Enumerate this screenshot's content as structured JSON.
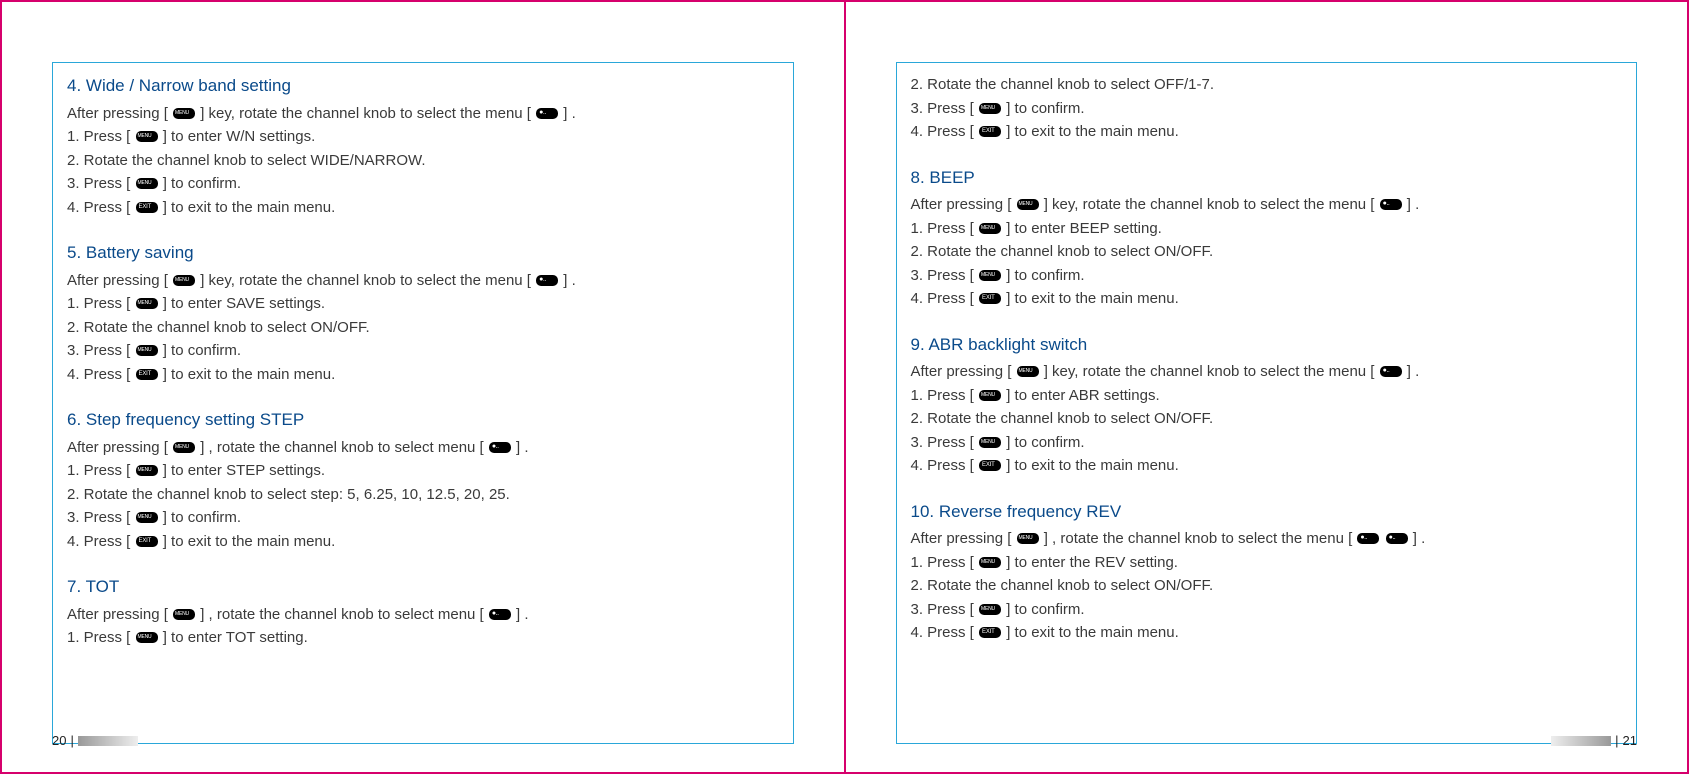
{
  "left": {
    "page_number": "20",
    "sections": [
      {
        "title": "4. Wide / Narrow band setting",
        "lines": [
          {
            "parts": [
              "After pressing [ ",
              {
                "key": "MENU"
              },
              " ] key, rotate the channel knob to select the menu [ ",
              {
                "key": "4"
              },
              " ] ."
            ]
          },
          {
            "parts": [
              "1. Press [ ",
              {
                "key": "MENU"
              },
              " ] to enter W/N settings."
            ]
          },
          {
            "parts": [
              "2. Rotate the channel knob to select WIDE/NARROW."
            ]
          },
          {
            "parts": [
              "3. Press [ ",
              {
                "key": "MENU"
              },
              " ] to confirm."
            ]
          },
          {
            "parts": [
              "4. Press [ ",
              {
                "key": "EXIT"
              },
              " ] to exit to the main menu."
            ]
          }
        ]
      },
      {
        "title": "5. Battery saving",
        "lines": [
          {
            "parts": [
              "After pressing [ ",
              {
                "key": "MENU"
              },
              " ] key, rotate the channel knob to select the menu [ ",
              {
                "key": "5"
              },
              " ] ."
            ]
          },
          {
            "parts": [
              "1. Press [ ",
              {
                "key": "MENU"
              },
              " ] to enter SAVE settings."
            ]
          },
          {
            "parts": [
              "2. Rotate the channel knob to select ON/OFF."
            ]
          },
          {
            "parts": [
              "3. Press [ ",
              {
                "key": "MENU"
              },
              " ] to confirm."
            ]
          },
          {
            "parts": [
              "4. Press [ ",
              {
                "key": "EXIT"
              },
              " ] to exit to the main menu."
            ]
          }
        ]
      },
      {
        "title": "6. Step frequency setting STEP",
        "lines": [
          {
            "parts": [
              "After pressing [ ",
              {
                "key": "MENU"
              },
              " ] , rotate the channel knob to select menu [ ",
              {
                "key": "6"
              },
              " ] ."
            ]
          },
          {
            "parts": [
              "1. Press [ ",
              {
                "key": "MENU"
              },
              " ] to enter STEP settings."
            ]
          },
          {
            "parts": [
              "2. Rotate the channel knob to select step: 5, 6.25, 10, 12.5, 20, 25."
            ]
          },
          {
            "parts": [
              "3. Press [ ",
              {
                "key": "MENU"
              },
              " ] to confirm."
            ]
          },
          {
            "parts": [
              "4. Press [ ",
              {
                "key": "EXIT"
              },
              " ] to exit to the main menu."
            ]
          }
        ]
      },
      {
        "title": "7. TOT",
        "lines": [
          {
            "parts": [
              "After pressing [ ",
              {
                "key": "MENU"
              },
              " ] , rotate the channel knob to select menu [ ",
              {
                "key": "7"
              },
              " ] ."
            ]
          },
          {
            "parts": [
              "1. Press [ ",
              {
                "key": "MENU"
              },
              " ] to enter TOT setting."
            ]
          }
        ]
      }
    ]
  },
  "right": {
    "page_number": "21",
    "prelines": [
      {
        "parts": [
          "2. Rotate the channel knob to select OFF/1-7."
        ]
      },
      {
        "parts": [
          "3. Press [ ",
          {
            "key": "MENU"
          },
          " ] to confirm."
        ]
      },
      {
        "parts": [
          "4. Press [ ",
          {
            "key": "EXIT"
          },
          " ] to exit to the main menu."
        ]
      }
    ],
    "sections": [
      {
        "title": "8. BEEP",
        "lines": [
          {
            "parts": [
              "After pressing [ ",
              {
                "key": "MENU"
              },
              " ] key, rotate the channel knob to select the menu [ ",
              {
                "key": "8"
              },
              " ] ."
            ]
          },
          {
            "parts": [
              "1. Press [ ",
              {
                "key": "MENU"
              },
              " ] to enter BEEP setting."
            ]
          },
          {
            "parts": [
              "2. Rotate the channel knob to select ON/OFF."
            ]
          },
          {
            "parts": [
              "3. Press [ ",
              {
                "key": "MENU"
              },
              " ] to confirm."
            ]
          },
          {
            "parts": [
              "4. Press [ ",
              {
                "key": "EXIT"
              },
              " ] to exit to the main menu."
            ]
          }
        ]
      },
      {
        "title": "9. ABR backlight switch",
        "lines": [
          {
            "parts": [
              "After pressing [ ",
              {
                "key": "MENU"
              },
              " ] key, rotate the channel knob to select the menu [ ",
              {
                "key": "9"
              },
              " ] ."
            ]
          },
          {
            "parts": [
              "1. Press [ ",
              {
                "key": "MENU"
              },
              " ] to enter ABR settings."
            ]
          },
          {
            "parts": [
              "2. Rotate the channel knob to select ON/OFF."
            ]
          },
          {
            "parts": [
              "3. Press [ ",
              {
                "key": "MENU"
              },
              " ] to confirm."
            ]
          },
          {
            "parts": [
              "4. Press [ ",
              {
                "key": "EXIT"
              },
              " ] to exit to the main menu."
            ]
          }
        ]
      },
      {
        "title": "10. Reverse frequency REV",
        "lines": [
          {
            "parts": [
              "After pressing [ ",
              {
                "key": "MENU"
              },
              " ] , rotate the channel knob to select the menu [ ",
              {
                "key": "1"
              },
              " ",
              {
                "key": "0"
              },
              " ] ."
            ]
          },
          {
            "parts": [
              "1. Press [ ",
              {
                "key": "MENU"
              },
              " ] to enter the REV setting."
            ]
          },
          {
            "parts": [
              "2. Rotate the channel knob to select ON/OFF."
            ]
          },
          {
            "parts": [
              "3. Press [ ",
              {
                "key": "MENU"
              },
              " ] to confirm."
            ]
          },
          {
            "parts": [
              "4. Press [ ",
              {
                "key": "EXIT"
              },
              " ] to exit to the main menu."
            ]
          }
        ]
      }
    ]
  }
}
